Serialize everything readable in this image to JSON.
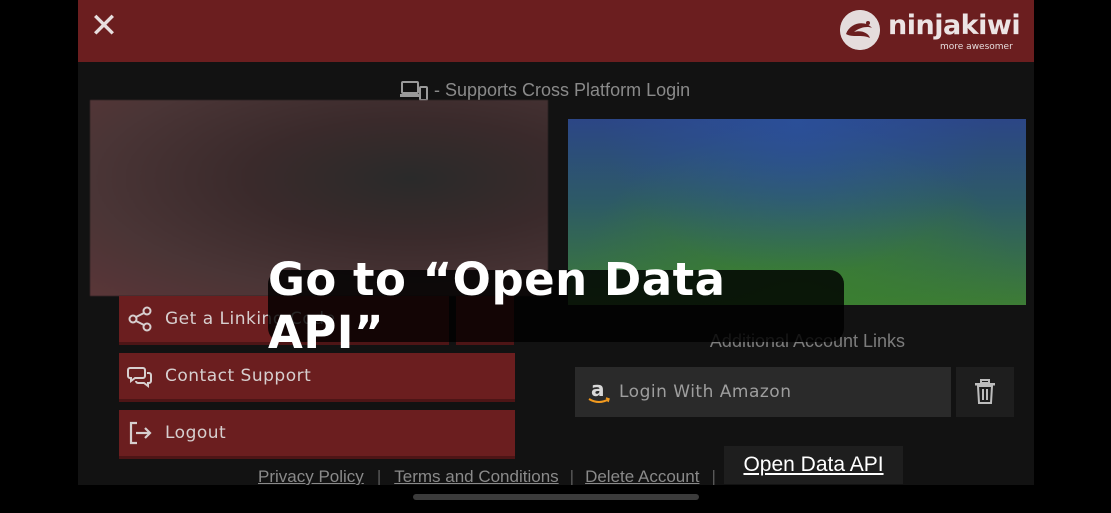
{
  "header": {
    "close_label": "✕",
    "logo": {
      "name": "ninjakiwi",
      "tagline": "more awesomer"
    }
  },
  "cross_platform_text": "- Supports Cross Platform Login",
  "buttons": {
    "linking": "Get a Linking Code",
    "contact": "Contact Support",
    "logout": "Logout"
  },
  "additional": {
    "title": "Additional Account Links",
    "amazon_label": "Login With Amazon"
  },
  "footer": {
    "privacy": "Privacy Policy",
    "terms": "Terms and Conditions",
    "delete": "Delete Account",
    "sep": "|",
    "open_api": "Open Data API"
  },
  "overlay": {
    "caption": "Go to “Open Data API”"
  },
  "colors": {
    "brand_red": "#6b1e1f",
    "background": "#121212",
    "panel": "#2a2a2a"
  }
}
